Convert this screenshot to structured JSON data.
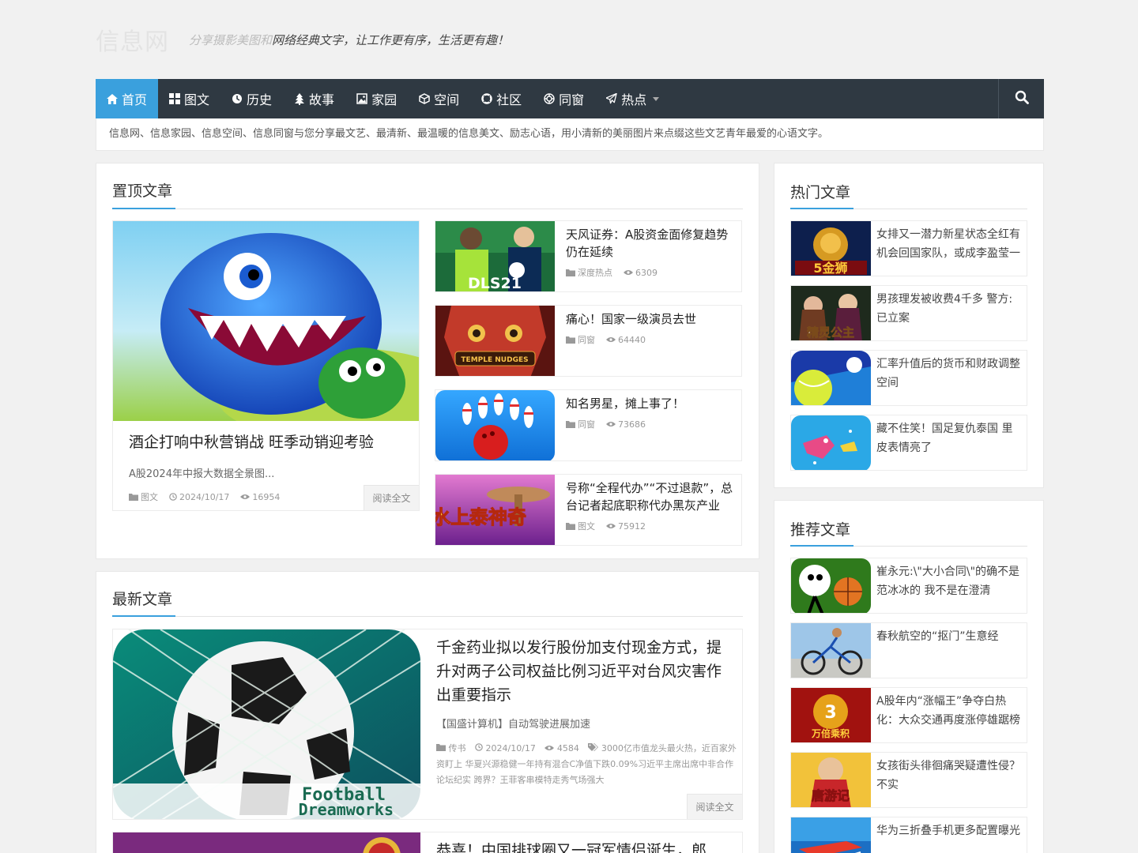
{
  "header": {
    "logo": "信息网",
    "slogan_fade": "分享摄影美图和",
    "slogan": "网络经典文字，让工作更有序，生活更有趣！"
  },
  "nav": {
    "items": [
      {
        "label": "首页",
        "icon": "home-icon"
      },
      {
        "label": "图文",
        "icon": "image-icon"
      },
      {
        "label": "历史",
        "icon": "history-icon"
      },
      {
        "label": "故事",
        "icon": "tree-icon"
      },
      {
        "label": "家园",
        "icon": "picture-icon"
      },
      {
        "label": "空间",
        "icon": "cube-icon"
      },
      {
        "label": "社区",
        "icon": "lifebuoy-icon"
      },
      {
        "label": "同窗",
        "icon": "empire-icon"
      },
      {
        "label": "热点",
        "icon": "paper-plane-icon"
      }
    ],
    "search_icon": "search-icon"
  },
  "notice": "信息网、信息家园、信息空间、信息同窗与您分享最文艺、最清新、最温暖的信息美文、励志心语，用小清新的美丽图片来点缀这些文艺青年最爱的心语文字。",
  "sticky": {
    "title": "置顶文章",
    "featured": {
      "title": "酒企打响中秋营销战 旺季动销迎考验",
      "desc": "A股2024年中报大数据全景图...",
      "category": "图文",
      "date": "2024/10/17",
      "views": "16954",
      "readmore": "阅读全文"
    },
    "items": [
      {
        "title": "天风证券：A股资金面修复趋势仍在延续",
        "category": "深度热点",
        "views": "6309",
        "img_label": "DLS21"
      },
      {
        "title": "痛心！国家一级演员去世",
        "category": "同窗",
        "views": "64440",
        "img_label": "TEMPLE NUDGES"
      },
      {
        "title": "知名男星，摊上事了！",
        "category": "同窗",
        "views": "73686",
        "img_label": ""
      },
      {
        "title": "号称“全程代办”“不过退款”，总台记者起底职称代办黑灰产业",
        "category": "图文",
        "views": "75912",
        "img_label": "水上泰神奇"
      }
    ]
  },
  "latest": {
    "title": "最新文章",
    "items": [
      {
        "title": "千金药业拟以发行股份加支付现金方式，提升对两子公司权益比例习近平对台风灾害作出重要指示",
        "desc": "【国盛计算机】自动驾驶进展加速",
        "category": "传书",
        "date": "2024/10/17",
        "views": "4584",
        "tags": "3000亿市值龙头最火热，近百家外资盯上 华夏兴源稳健一年持有混合C净值下跌0.09%习近平主席出席中非合作论坛纪实 跨界？王菲客串模特走秀气场强大",
        "readmore": "阅读全文",
        "img_label_1": "Football",
        "img_label_2": "Dreamworks"
      },
      {
        "title": "恭喜！中国排球圈又一冠军情侣诞生，郎"
      }
    ]
  },
  "hot": {
    "title": "热门文章",
    "items": [
      {
        "title": "女排又一潜力新星状态全红有机会回国家队，或成李盈莹一",
        "img_label": "5金狮"
      },
      {
        "title": "男孩理发被收费4千多 警方:已立案",
        "img_label": "精灵公主"
      },
      {
        "title": "汇率升值后的货币和财政调整空间",
        "img_label": ""
      },
      {
        "title": "藏不住笑！国足复仇泰国 里皮表情亮了",
        "img_label": ""
      }
    ]
  },
  "recommend": {
    "title": "推荐文章",
    "items": [
      {
        "title": "崔永元:\\\"大小合同\\\"的确不是范冰冰的 我不是在澄清",
        "img_label": ""
      },
      {
        "title": "春秋航空的“抠门”生意经",
        "img_label": ""
      },
      {
        "title": "A股年内“涨幅王”争夺白热化：大众交通再度涨停雄踞榜",
        "img_label": "万倍乘积"
      },
      {
        "title": "女孩街头徘徊痛哭疑遭性侵？不实",
        "img_label": "唐游记"
      },
      {
        "title": "华为三折叠手机更多配置曝光",
        "img_label": ""
      }
    ]
  }
}
